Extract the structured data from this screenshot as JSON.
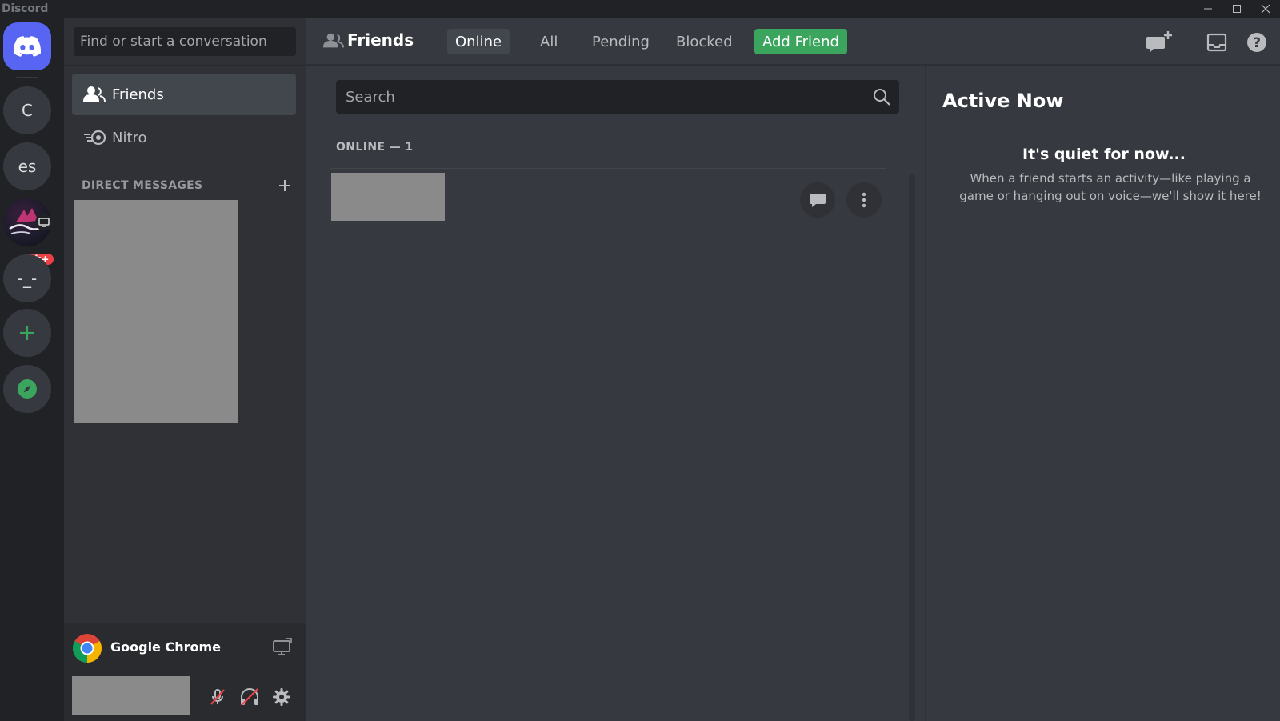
{
  "window": {
    "app_title": "Discord",
    "controls": [
      "minimize",
      "maximize",
      "close"
    ]
  },
  "guilds": {
    "items": [
      {
        "name": "home",
        "icon": "discord-logo-icon"
      },
      {
        "name": "server-c",
        "label": "C"
      },
      {
        "name": "server-es",
        "label": "es"
      },
      {
        "name": "server-image",
        "badge": "2k+",
        "status_icon": "screen-share-icon"
      },
      {
        "name": "server-dash",
        "label": "-_-"
      },
      {
        "name": "add-server",
        "icon": "plus-icon"
      },
      {
        "name": "explore",
        "icon": "compass-icon"
      }
    ]
  },
  "sidebar": {
    "search_placeholder": "Find or start a conversation",
    "nav": [
      {
        "label": "Friends",
        "icon": "friends-icon",
        "active": true
      },
      {
        "label": "Nitro",
        "icon": "nitro-icon",
        "active": false
      }
    ],
    "dm_header": "DIRECT MESSAGES",
    "dm_add_icon": "plus-icon"
  },
  "activity": {
    "app_name": "Google Chrome",
    "icon": "chrome-icon",
    "action_icon": "stream-screen-icon"
  },
  "user_panel": {
    "buttons": [
      "mic-muted-icon",
      "headphones-deafened-icon",
      "gear-icon"
    ]
  },
  "topbar": {
    "title": "Friends",
    "tabs": [
      "Online",
      "All",
      "Pending",
      "Blocked"
    ],
    "selected_tab": "Online",
    "add_friend_label": "Add Friend",
    "right_icons": [
      "new-group-dm-icon",
      "inbox-icon",
      "help-icon"
    ]
  },
  "friends": {
    "search_placeholder": "Search",
    "online_header": "ONLINE — 1",
    "row_actions": [
      "message-icon",
      "more-icon"
    ]
  },
  "active_now": {
    "title": "Active Now",
    "quiet_title": "It's quiet for now...",
    "quiet_desc": "When a friend starts an activity—like playing a game or hanging out on voice—we'll show it here!"
  },
  "colors": {
    "blurple": "#5865f2",
    "green": "#3ba55d",
    "red": "#ed4245",
    "bg_main": "#36393f",
    "bg_sidebar": "#2f3136",
    "bg_guilds": "#202225"
  }
}
